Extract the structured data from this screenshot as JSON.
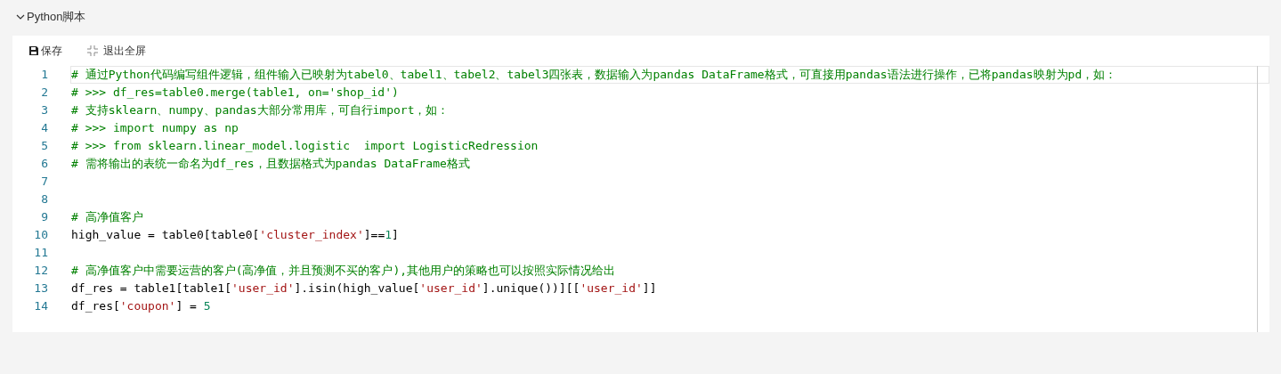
{
  "section": {
    "title": "Python脚本",
    "expanded": true
  },
  "toolbar": [
    {
      "kind": "save",
      "label": "保存"
    },
    {
      "kind": "exit_fullscreen",
      "label": "退出全屏"
    }
  ],
  "editor": {
    "lines": [
      {
        "number": "1",
        "active": true,
        "tokens": [
          {
            "kind": "comment",
            "text": "# 通过Python代码编写组件逻辑，组件输入已映射为tabel0、tabel1、tabel2、tabel3四张表，数据输入为pandas DataFrame格式，可直接用pandas语法进行操作，已将pandas映射为pd，如："
          }
        ]
      },
      {
        "number": "2",
        "active": false,
        "tokens": [
          {
            "kind": "comment",
            "text": "# >>> df_res=table0.merge(table1, on='shop_id')"
          }
        ]
      },
      {
        "number": "3",
        "active": false,
        "tokens": [
          {
            "kind": "comment",
            "text": "# 支持sklearn、numpy、pandas大部分常用库，可自行import，如："
          }
        ]
      },
      {
        "number": "4",
        "active": false,
        "tokens": [
          {
            "kind": "comment",
            "text": "# >>> import numpy as np"
          }
        ]
      },
      {
        "number": "5",
        "active": false,
        "tokens": [
          {
            "kind": "comment",
            "text": "# >>> from sklearn.linear_model.logistic  import LogisticRedression"
          }
        ]
      },
      {
        "number": "6",
        "active": false,
        "tokens": [
          {
            "kind": "comment",
            "text": "# 需将输出的表统一命名为df_res，且数据格式为pandas DataFrame格式"
          }
        ]
      },
      {
        "number": "7",
        "active": false
      },
      {
        "number": "8",
        "active": false
      },
      {
        "number": "9",
        "active": false,
        "tokens": [
          {
            "kind": "comment",
            "text": "# 高净值客户"
          }
        ]
      },
      {
        "number": "10",
        "active": false,
        "tokens": [
          {
            "kind": "plain",
            "text": "high_value = table0[table0["
          },
          {
            "kind": "string",
            "text": "'cluster_index'"
          },
          {
            "kind": "plain",
            "text": "]=="
          },
          {
            "kind": "number",
            "text": "1"
          },
          {
            "kind": "plain",
            "text": "]"
          }
        ]
      },
      {
        "number": "11",
        "active": false
      },
      {
        "number": "12",
        "active": false,
        "tokens": [
          {
            "kind": "comment",
            "text": "# 高净值客户中需要运营的客户(高净值，并且预测不买的客户),其他用户的策略也可以按照实际情况给出"
          }
        ]
      },
      {
        "number": "13",
        "active": false,
        "tokens": [
          {
            "kind": "plain",
            "text": "df_res = table1[table1["
          },
          {
            "kind": "string",
            "text": "'user_id'"
          },
          {
            "kind": "plain",
            "text": "].isin(high_value["
          },
          {
            "kind": "string",
            "text": "'user_id'"
          },
          {
            "kind": "plain",
            "text": "].unique())][["
          },
          {
            "kind": "string",
            "text": "'user_id'"
          },
          {
            "kind": "plain",
            "text": "]]"
          }
        ]
      },
      {
        "number": "14",
        "active": false,
        "tokens": [
          {
            "kind": "plain",
            "text": "df_res["
          },
          {
            "kind": "string",
            "text": "'coupon'"
          },
          {
            "kind": "plain",
            "text": "] = "
          },
          {
            "kind": "number",
            "text": "5"
          }
        ]
      }
    ]
  }
}
